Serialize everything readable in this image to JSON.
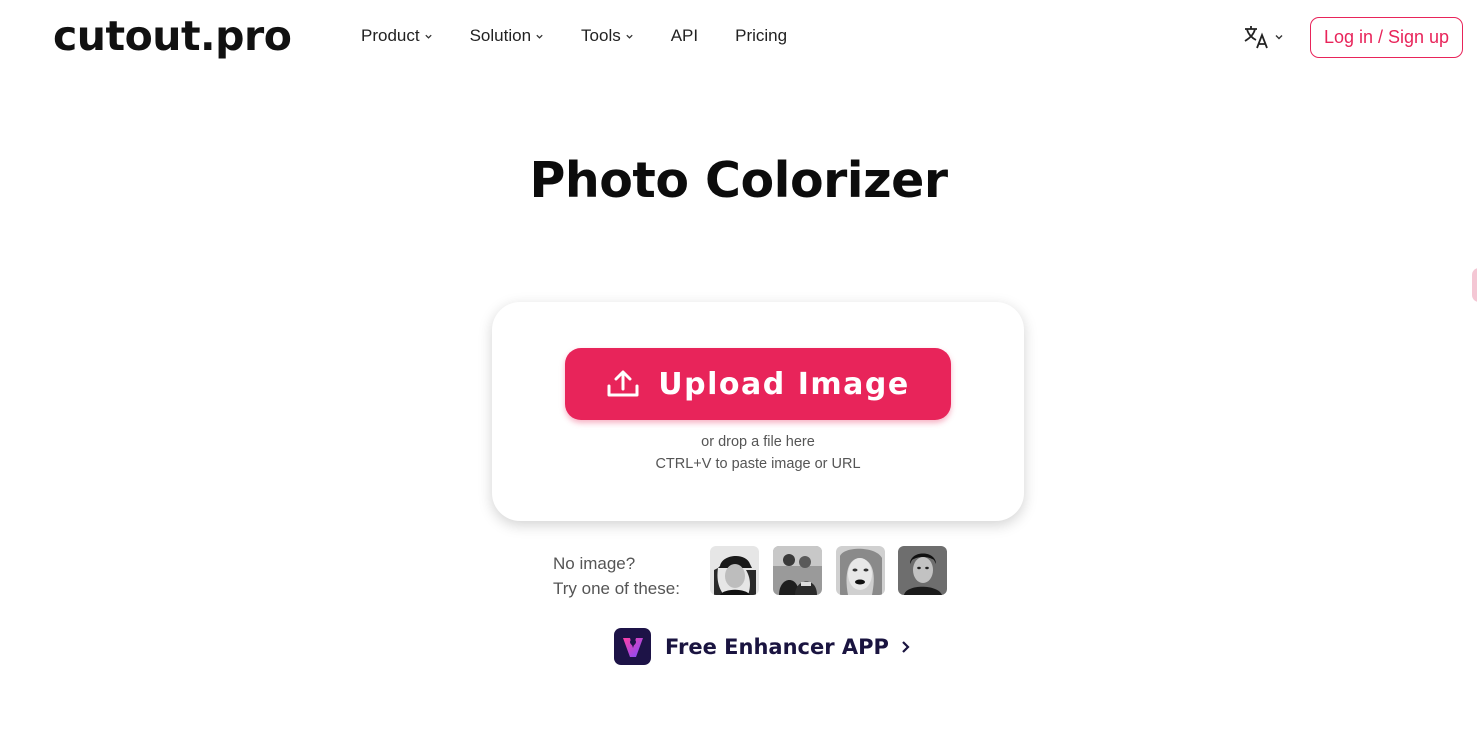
{
  "brand": {
    "logo_text": "cutout.pro",
    "accent_color": "#e8245a"
  },
  "nav": {
    "items": [
      {
        "label": "Product",
        "has_dropdown": true
      },
      {
        "label": "Solution",
        "has_dropdown": true
      },
      {
        "label": "Tools",
        "has_dropdown": true
      },
      {
        "label": "API",
        "has_dropdown": false
      },
      {
        "label": "Pricing",
        "has_dropdown": false
      }
    ],
    "language_icon": "translate-icon",
    "login_label": "Log in / Sign up"
  },
  "main": {
    "title": "Photo Colorizer",
    "upload": {
      "button_label": "Upload Image",
      "icon": "upload-icon",
      "drop_hint": "or drop a file here",
      "paste_hint": "CTRL+V to paste image or URL"
    },
    "samples": {
      "label_line1": "No image?",
      "label_line2": "Try one of these:",
      "thumbnails": [
        "sample-woman-cap",
        "sample-couple-street",
        "sample-woman-lips",
        "sample-man-portrait"
      ]
    },
    "app_promo": {
      "label": "Free Enhancer APP",
      "icon": "enhancer-app-icon"
    }
  }
}
